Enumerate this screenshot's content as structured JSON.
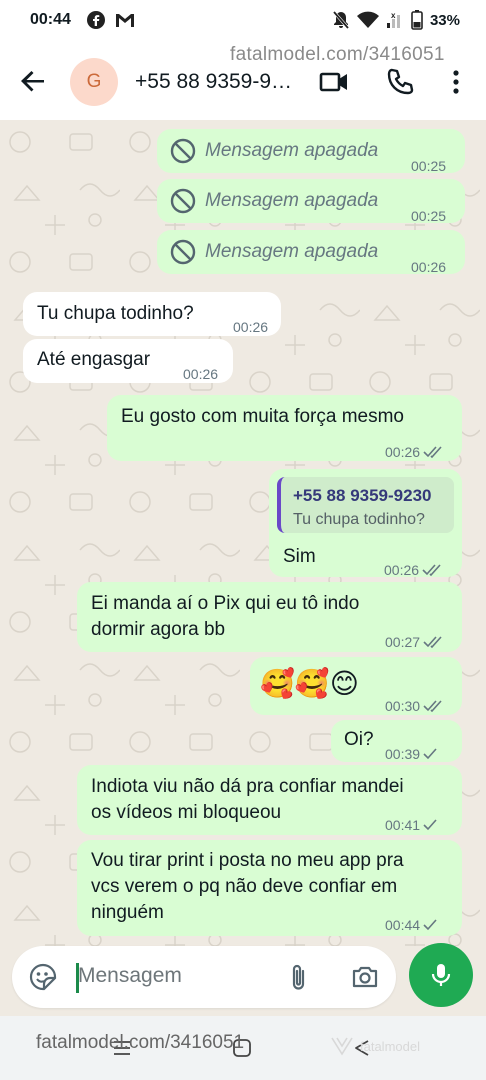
{
  "status_bar": {
    "time": "00:44",
    "battery": "33%",
    "icons": [
      "facebook-icon",
      "gmail-icon",
      "mute-icon",
      "wifi-icon",
      "signal-icon",
      "battery-icon"
    ]
  },
  "header": {
    "watermark": "fatalmodel.com/3416051",
    "avatar_letter": "G",
    "contact_name": "+55 88 9359-9…",
    "icons": [
      "back-arrow-icon",
      "video-call-icon",
      "voice-call-icon",
      "more-options-icon"
    ]
  },
  "messages": [
    {
      "id": "m1",
      "direction": "out",
      "text": "Mensagem apagada",
      "time": "00:25",
      "deleted": true
    },
    {
      "id": "m2",
      "direction": "out",
      "text": "Mensagem apagada",
      "time": "00:25",
      "deleted": true
    },
    {
      "id": "m3",
      "direction": "out",
      "text": "Mensagem apagada",
      "time": "00:26",
      "deleted": true
    },
    {
      "id": "m4",
      "direction": "in",
      "text": "Tu chupa todinho?",
      "time": "00:26"
    },
    {
      "id": "m5",
      "direction": "in",
      "text": "Até engasgar",
      "time": "00:26"
    },
    {
      "id": "m6",
      "direction": "out",
      "text": "Eu gosto com muita força mesmo",
      "time": "00:26",
      "status": "read"
    },
    {
      "id": "m7",
      "direction": "out",
      "text": "Sim",
      "time": "00:26",
      "status": "read",
      "quote": {
        "name": "+55 88 9359-9230",
        "text": "Tu chupa todinho?"
      }
    },
    {
      "id": "m8",
      "direction": "out",
      "lines": [
        "Ei manda aí o Pix qui eu tô indo",
        "dormir agora bb"
      ],
      "time": "00:27",
      "status": "read"
    },
    {
      "id": "m9",
      "direction": "out",
      "text": "🥰🥰😊",
      "time": "00:30",
      "status": "read"
    },
    {
      "id": "m10",
      "direction": "out",
      "text": "Oi?",
      "time": "00:39",
      "status": "sent"
    },
    {
      "id": "m11",
      "direction": "out",
      "lines": [
        "Indiota viu não dá pra confiar mandei",
        "os vídeos mi bloqueou"
      ],
      "time": "00:41",
      "status": "sent"
    },
    {
      "id": "m12",
      "direction": "out",
      "lines": [
        "Vou tirar print i posta no meu app pra",
        "vcs verem o pq não deve confiar em",
        "ninguém"
      ],
      "time": "00:44",
      "status": "sent"
    }
  ],
  "input": {
    "placeholder": "Mensagem",
    "icons": [
      "sticker-icon",
      "attach-icon",
      "camera-icon",
      "mic-icon"
    ]
  },
  "nav_bar": {
    "watermark": "fatalmodel.com/3416051",
    "logo_text": "fatalmodel",
    "icons": [
      "recents-icon",
      "home-icon",
      "back-icon"
    ]
  },
  "colors": {
    "outgoing_bubble": "#d9fdd3",
    "incoming_bubble": "#ffffff",
    "chat_background": "#efeae2",
    "accent_green": "#1faa53",
    "read_tick": "#667781",
    "quote_bar": "#6a49c8"
  }
}
